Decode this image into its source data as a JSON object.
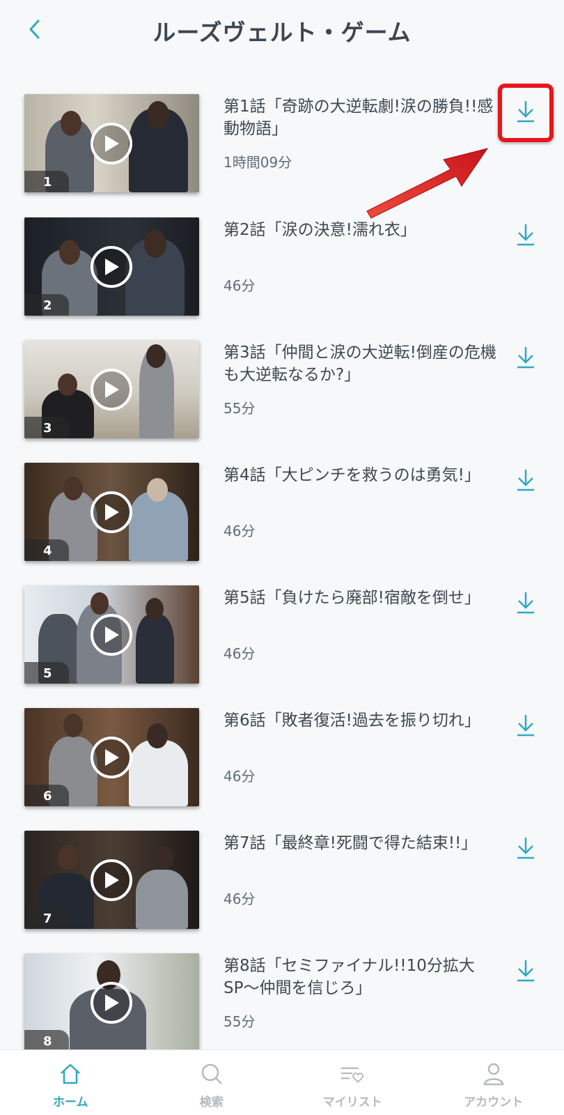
{
  "header": {
    "title": "ルーズヴェルト・ゲーム"
  },
  "accent_color": "#2fa7c4",
  "highlight_color": "#e8151b",
  "episodes": [
    {
      "number": "1",
      "title": "第1話「奇跡の大逆転劇!涙の勝負!!感動物語」",
      "duration": "1時間09分"
    },
    {
      "number": "2",
      "title": "第2話「涙の決意!濡れ衣」",
      "duration": "46分"
    },
    {
      "number": "3",
      "title": "第3話「仲間と涙の大逆転!倒産の危機も大逆転なるか?」",
      "duration": "55分"
    },
    {
      "number": "4",
      "title": "第4話「大ピンチを救うのは勇気!」",
      "duration": "46分"
    },
    {
      "number": "5",
      "title": "第5話「負けたら廃部!宿敵を倒せ」",
      "duration": "46分"
    },
    {
      "number": "6",
      "title": "第6話「敗者復活!過去を振り切れ」",
      "duration": "46分"
    },
    {
      "number": "7",
      "title": "第7話「最終章!死闘で得た結束!!」",
      "duration": "46分"
    },
    {
      "number": "8",
      "title": "第8話「セミファイナル!!10分拡大SP〜仲間を信じろ」",
      "duration": "55分"
    }
  ],
  "tabbar": {
    "home": "ホーム",
    "search": "検索",
    "mylist": "マイリスト",
    "account": "アカウント"
  }
}
